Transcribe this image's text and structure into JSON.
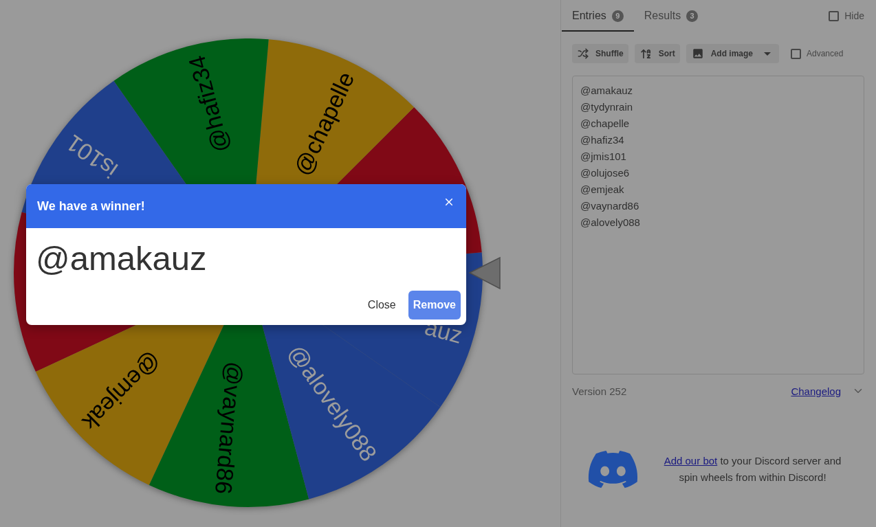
{
  "wheel": {
    "slices": [
      {
        "label": "auz",
        "color": "#1f3f8b"
      },
      {
        "color": "#800916"
      },
      {
        "label": "@chapelle",
        "color": "#8f6b0a"
      },
      {
        "label": "@hafiz34",
        "color": "#005f18"
      },
      {
        "label": "is101",
        "color": "#1f3f8b"
      },
      {
        "color": "#800916"
      },
      {
        "label": "@emjeak",
        "color": "#8f6b0a"
      },
      {
        "label": "@vaynard86",
        "color": "#005f18"
      },
      {
        "label": "@alovely088",
        "color": "#1f3f8b"
      }
    ]
  },
  "dialog": {
    "title": "We have a winner!",
    "winner": "@amakauz",
    "buttons": [
      {
        "label": "Close",
        "kind": "text"
      },
      {
        "label": "Remove",
        "kind": "primary"
      }
    ]
  },
  "tabs": [
    {
      "label": "Entries",
      "count": "9",
      "selected": true
    },
    {
      "label": "Results",
      "count": "3",
      "selected": false
    }
  ],
  "hide": {
    "label": "Hide",
    "checked": false
  },
  "toolbar": {
    "buttons": [
      {
        "label": "Shuffle",
        "kind": "plain"
      },
      {
        "label": "Sort",
        "kind": "plain"
      },
      {
        "label": "Add image",
        "kind": "dropdown"
      }
    ],
    "advanced": {
      "label": "Advanced",
      "checked": false
    }
  },
  "entries": [
    "@amakauz",
    "@tydynrain",
    "@chapelle",
    "@hafiz34",
    "@jmis101",
    "@olujose6",
    "@emjeak",
    "@vaynard86",
    "@alovely088"
  ],
  "version": {
    "label": "Version 252",
    "changelog": "Changelog"
  },
  "discord": {
    "link": "Add our bot",
    "text": "to your Discord server and spin wheels from within Discord!"
  }
}
